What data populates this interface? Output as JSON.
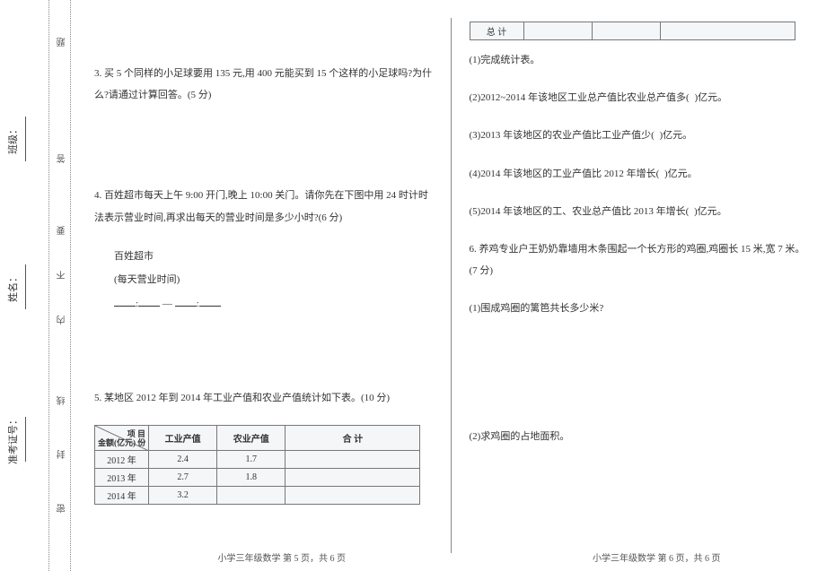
{
  "binding": {
    "class_label": "班级：",
    "name_label": "姓名：",
    "exam_id_label": "准考证号：",
    "warn1": "题",
    "warn2": "答",
    "warn3": "要",
    "warn4": "不",
    "warn5": "内",
    "warn6": "线",
    "warn7": "封",
    "warn8": "密"
  },
  "q3": "3. 买 5 个同样的小足球要用 135 元,用 400 元能买到 15 个这样的小足球吗?为什么?请通过计算回答。(5 分)",
  "q4": {
    "text": "4. 百姓超市每天上午 9:00 开门,晚上 10:00 关门。请你先在下图中用 24 时计时法表示营业时间,再求出每天的营业时间是多少小时?(6 分)",
    "shop_name": "百姓超市",
    "shop_sub": "(每天营业时间)"
  },
  "q5": {
    "text": "5. 某地区 2012 年到 2014 年工业产值和农业产值统计如下表。(10 分)",
    "diag_top": "项   目",
    "diag_bot": "金额(亿元)  份",
    "col1": "工业产值",
    "col2": "农业产值",
    "col3": "合   计",
    "rows": [
      {
        "y": "2012 年",
        "a": "2.4",
        "b": "1.7"
      },
      {
        "y": "2013 年",
        "a": "2.7",
        "b": "1.8"
      },
      {
        "y": "2014 年",
        "a": "3.2",
        "b": ""
      }
    ],
    "total_row": "总   计"
  },
  "q5_subs": {
    "s1": "(1)完成统计表。",
    "s2a": "(2)2012~2014 年该地区工业总产值比农业总产值多(",
    "s2b": ")亿元。",
    "s3a": "(3)2013 年该地区的农业产值比工业产值少(",
    "s3b": ")亿元。",
    "s4a": "(4)2014 年该地区的工业产值比 2012 年增长(",
    "s4b": ")亿元。",
    "s5a": "(5)2014 年该地区的工、农业总产值比 2013 年增长(",
    "s5b": ")亿元。"
  },
  "q6": {
    "text": "6. 养鸡专业户王奶奶靠墙用木条围起一个长方形的鸡圈,鸡圈长 15 米,宽 7 米。(7 分)",
    "s1": "(1)围成鸡圈的篱笆共长多少米?",
    "s2": "(2)求鸡圈的占地面积。"
  },
  "footers": {
    "p5": "小学三年级数学   第 5 页，共 6 页",
    "p6": "小学三年级数学   第 6 页，共 6 页"
  }
}
